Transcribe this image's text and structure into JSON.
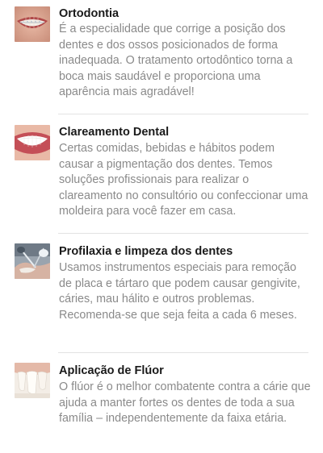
{
  "services": [
    {
      "icon": "smile-braces-icon",
      "title": "Ortodontia",
      "description": "É a especialidade que corrige a posição dos dentes e dos ossos posicionados de forma inadequada. O tratamento ortodôntico torna a boca mais saudável e proporciona uma aparência mais agradável!"
    },
    {
      "icon": "white-smile-icon",
      "title": "Clareamento Dental",
      "description": "Certas comidas, bebidas e hábitos podem causar a pigmentação dos dentes. Temos soluções profissionais para realizar o clareamento no consultório ou confeccionar uma moldeira para você fazer em casa."
    },
    {
      "icon": "dental-cleaning-icon",
      "title": "Profilaxia e limpeza dos dentes",
      "description": "Usamos instrumentos especiais para remoção de placa e tártaro que podem causar gengivite, cáries, mau hálito e outros problemas. Recomenda-se que seja feita a cada 6 meses."
    },
    {
      "icon": "fluoride-teeth-icon",
      "title": "Aplicação de Flúor",
      "description": "O flúor é o melhor combatente contra a cárie que ajuda a manter fortes os dentes de toda a sua família – independentemente da faixa etária."
    }
  ]
}
